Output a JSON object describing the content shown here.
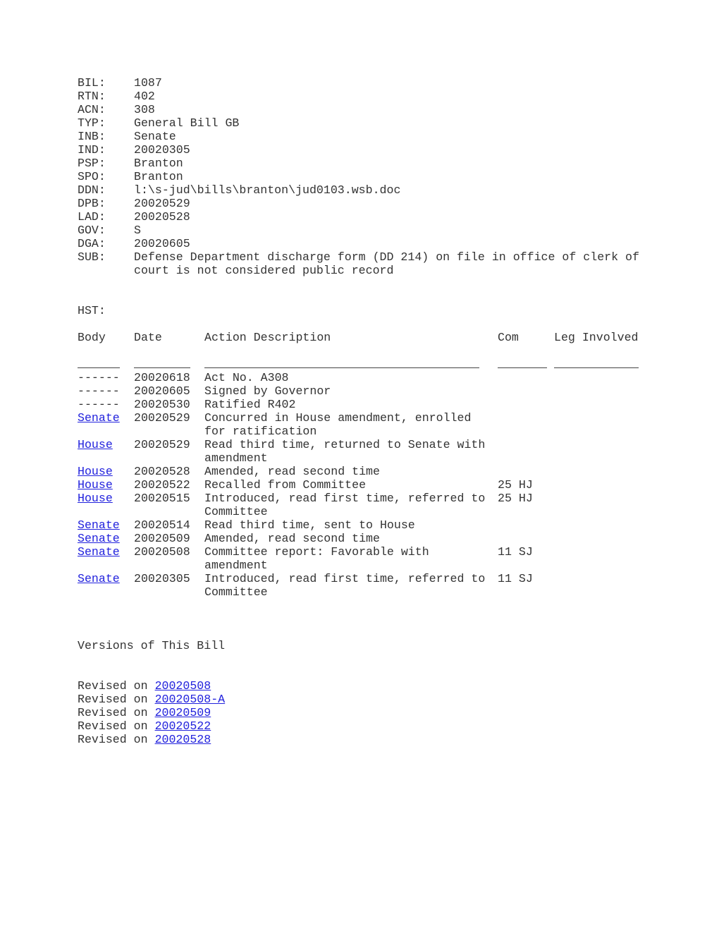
{
  "fields": [
    {
      "key": "BIL:",
      "value": "1087"
    },
    {
      "key": "RTN:",
      "value": "402"
    },
    {
      "key": "ACN:",
      "value": "308"
    },
    {
      "key": "TYP:",
      "value": "General Bill GB"
    },
    {
      "key": "INB:",
      "value": "Senate"
    },
    {
      "key": "IND:",
      "value": "20020305"
    },
    {
      "key": "PSP:",
      "value": "Branton"
    },
    {
      "key": "SPO:",
      "value": "Branton"
    },
    {
      "key": "DDN:",
      "value": "l:\\s-jud\\bills\\branton\\jud0103.wsb.doc"
    },
    {
      "key": "DPB:",
      "value": "20020529"
    },
    {
      "key": "LAD:",
      "value": "20020528"
    },
    {
      "key": "GOV:",
      "value": "S"
    },
    {
      "key": "DGA:",
      "value": "20020605"
    },
    {
      "key": "SUB:",
      "value": "Defense Department discharge form (DD 214) on file in office of clerk of court is not considered public record"
    }
  ],
  "history": {
    "label": "HST:",
    "headers": {
      "body": "Body",
      "date": "Date",
      "desc": "Action Description",
      "com": "Com",
      "leg": "Leg Involved"
    },
    "rows": [
      {
        "body": "------",
        "link": false,
        "date": "20020618",
        "desc": "Act No. A308",
        "com": ""
      },
      {
        "body": "------",
        "link": false,
        "date": "20020605",
        "desc": "Signed by Governor",
        "com": ""
      },
      {
        "body": "------",
        "link": false,
        "date": "20020530",
        "desc": "Ratified R402",
        "com": ""
      },
      {
        "body": "Senate",
        "link": true,
        "date": "20020529",
        "desc": "Concurred in House amendment, enrolled for ratification",
        "com": ""
      },
      {
        "body": "House",
        "link": true,
        "date": "20020529",
        "desc": "Read third time, returned to Senate with amendment",
        "com": ""
      },
      {
        "body": "House",
        "link": true,
        "date": "20020528",
        "desc": "Amended, read second time",
        "com": ""
      },
      {
        "body": "House",
        "link": true,
        "date": "20020522",
        "desc": "Recalled from Committee",
        "com": "25 HJ"
      },
      {
        "body": "House",
        "link": true,
        "date": "20020515",
        "desc": "Introduced, read first time, referred to Committee",
        "com": "25 HJ"
      },
      {
        "body": "Senate",
        "link": true,
        "date": "20020514",
        "desc": "Read third time, sent to House",
        "com": ""
      },
      {
        "body": "Senate",
        "link": true,
        "date": "20020509",
        "desc": "Amended, read second time",
        "com": ""
      },
      {
        "body": "Senate",
        "link": true,
        "date": "20020508",
        "desc": "Committee report: Favorable with amendment",
        "com": "11 SJ"
      },
      {
        "body": "Senate",
        "link": true,
        "date": "20020305",
        "desc": "Introduced, read first time, referred to Committee",
        "com": "11 SJ"
      }
    ]
  },
  "versions": {
    "title": "Versions of This Bill",
    "prefix": "Revised on",
    "items": [
      "20020508",
      "20020508-A",
      "20020509",
      "20020522",
      "20020528"
    ]
  }
}
